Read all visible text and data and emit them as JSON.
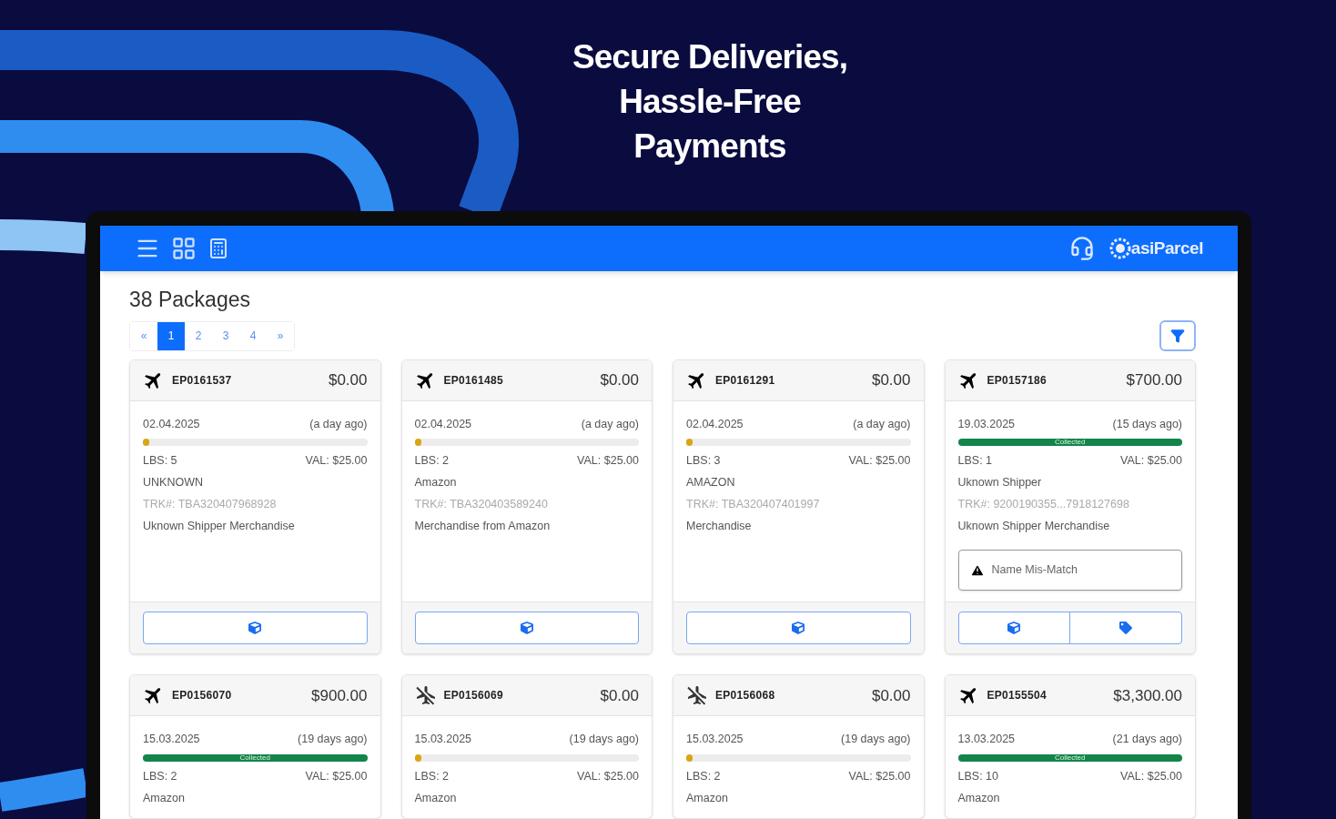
{
  "headline": [
    "Secure Deliveries,",
    "Hassle-Free",
    "Payments"
  ],
  "app": {
    "brand": "asiParcel",
    "title": "38 Packages",
    "pagination": [
      {
        "label": "«",
        "selected": false
      },
      {
        "label": "1",
        "selected": true
      },
      {
        "label": "2",
        "selected": false
      },
      {
        "label": "3",
        "selected": false
      },
      {
        "label": "4",
        "selected": false
      },
      {
        "label": "»",
        "selected": false
      }
    ],
    "packages": [
      {
        "kind": "air",
        "id": "EP0161537",
        "amount": "$0.00",
        "date": "02.04.2025",
        "age": "(a day ago)",
        "collected": false,
        "level": 0.03,
        "lbs": "LBS: 5",
        "val": "VAL: $25.00",
        "shipper": "UNKNOWN",
        "tracking": "TRK#: TBA320407968928",
        "description": "Uknown Shipper Merchandise",
        "actions": [
          {
            "kind": "box"
          }
        ]
      },
      {
        "kind": "air",
        "id": "EP0161485",
        "amount": "$0.00",
        "date": "02.04.2025",
        "age": "(a day ago)",
        "collected": false,
        "level": 0.03,
        "lbs": "LBS: 2",
        "val": "VAL: $25.00",
        "shipper": "Amazon",
        "tracking": "TRK#: TBA320403589240",
        "description": "Merchandise from Amazon",
        "actions": [
          {
            "kind": "box"
          }
        ]
      },
      {
        "kind": "air",
        "id": "EP0161291",
        "amount": "$0.00",
        "date": "02.04.2025",
        "age": "(a day ago)",
        "collected": false,
        "level": 0.03,
        "lbs": "LBS: 3",
        "val": "VAL: $25.00",
        "shipper": "AMAZON",
        "tracking": "TRK#: TBA320407401997",
        "description": "Merchandise",
        "actions": [
          {
            "kind": "box"
          }
        ]
      },
      {
        "kind": "air",
        "id": "EP0157186",
        "amount": "$700.00",
        "date": "19.03.2025",
        "age": "(15 days ago)",
        "collected": true,
        "status_label": "Collected",
        "level": 1,
        "lbs": "LBS: 1",
        "val": "VAL: $25.00",
        "shipper": "Uknown Shipper",
        "tracking": "TRK#: 9200190355...7918127698",
        "description": "Uknown Shipper Merchandise",
        "alert": "Name Mis-Match",
        "actions": [
          {
            "kind": "box"
          },
          {
            "kind": "tag"
          }
        ]
      },
      {
        "kind": "air",
        "id": "EP0156070",
        "amount": "$900.00",
        "date": "15.03.2025",
        "age": "(19 days ago)",
        "collected": true,
        "status_label": "Collected",
        "level": 1,
        "lbs": "LBS: 2",
        "val": "VAL: $25.00",
        "shipper": "Amazon"
      },
      {
        "kind": "air_off",
        "id": "EP0156069",
        "amount": "$0.00",
        "date": "15.03.2025",
        "age": "(19 days ago)",
        "collected": false,
        "level": 0.03,
        "lbs": "LBS: 2",
        "val": "VAL: $25.00",
        "shipper": "Amazon"
      },
      {
        "kind": "air_off",
        "id": "EP0156068",
        "amount": "$0.00",
        "date": "15.03.2025",
        "age": "(19 days ago)",
        "collected": false,
        "level": 0.03,
        "lbs": "LBS: 2",
        "val": "VAL: $25.00",
        "shipper": "Amazon"
      },
      {
        "kind": "air",
        "id": "EP0155504",
        "amount": "$3,300.00",
        "date": "13.03.2025",
        "age": "(21 days ago)",
        "collected": true,
        "status_label": "Collected",
        "level": 1,
        "lbs": "LBS: 10",
        "val": "VAL: $25.00",
        "shipper": "Amazon"
      }
    ]
  }
}
